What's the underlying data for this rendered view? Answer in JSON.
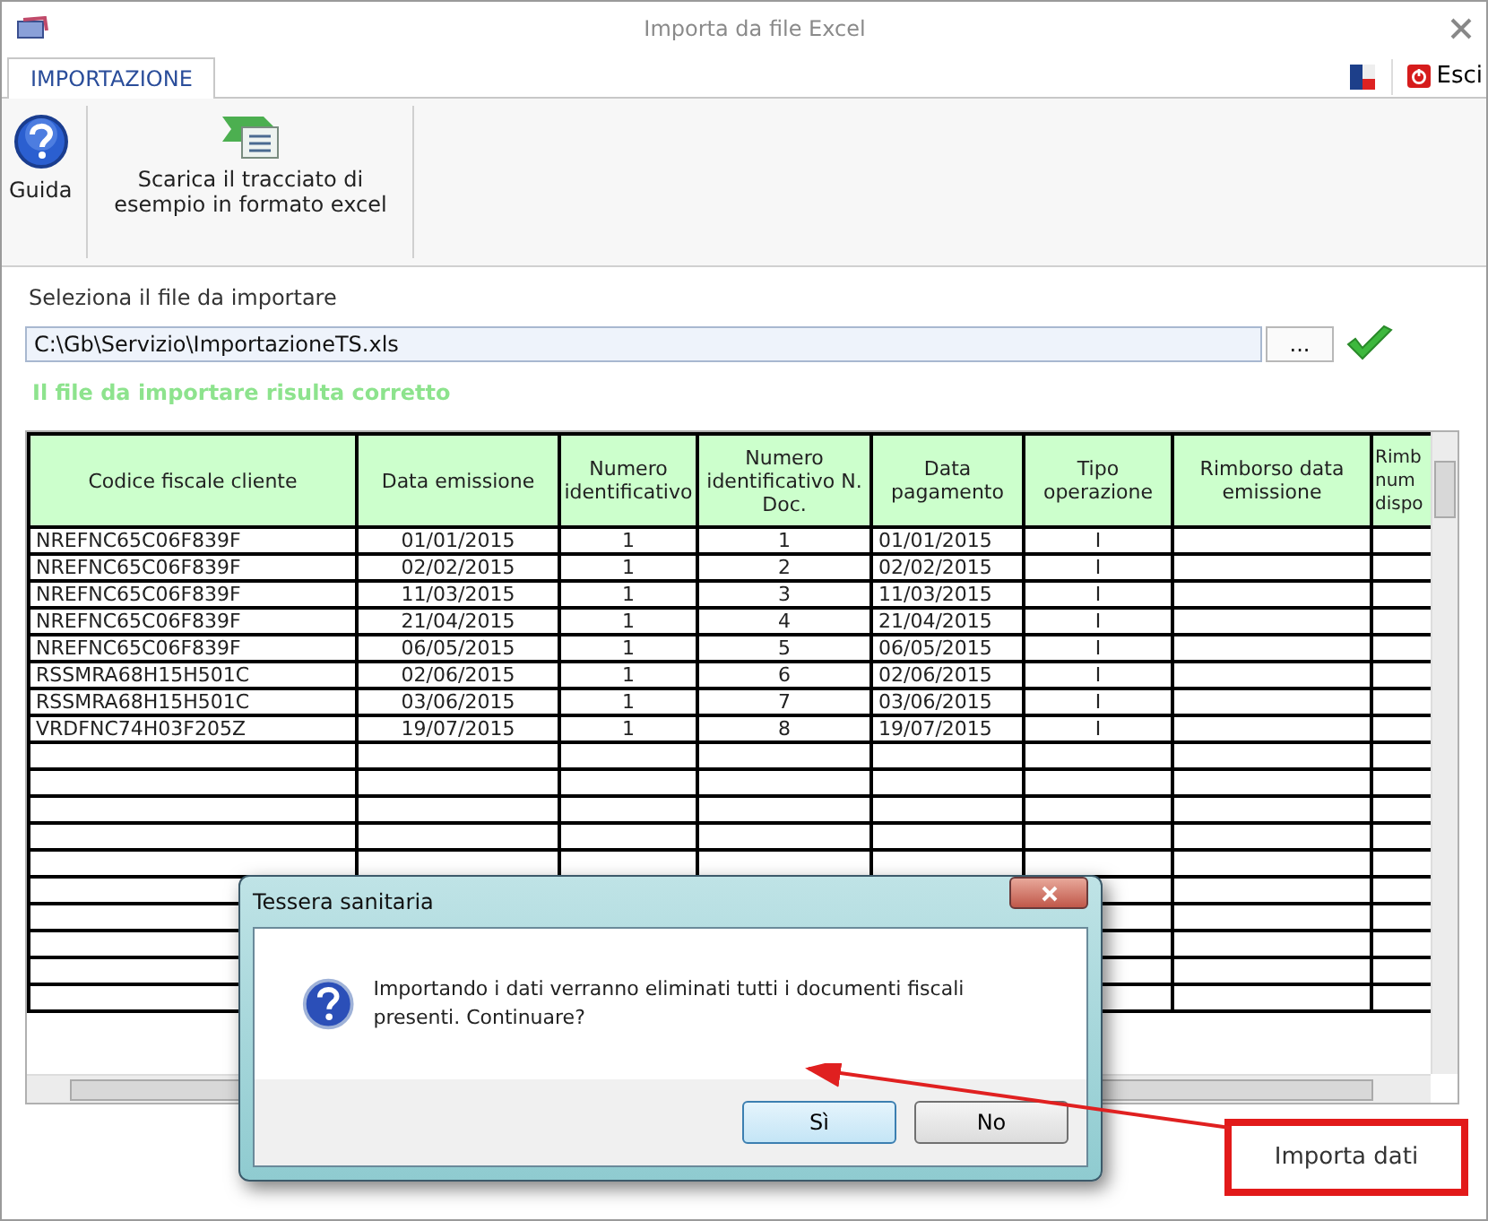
{
  "window": {
    "title": "Importa da file Excel"
  },
  "tabs": [
    {
      "label": "IMPORTAZIONE",
      "selected": true
    }
  ],
  "top_right": {
    "exit_label": "Esci"
  },
  "ribbon": {
    "buttons": [
      {
        "kind": "help",
        "label": "Guida"
      },
      {
        "kind": "excel",
        "label": "Scarica il tracciato di esempio in formato excel"
      }
    ]
  },
  "file": {
    "label": "Seleziona il file da importare",
    "value": "C:\\Gb\\Servizio\\ImportazioneTS.xls",
    "browse": "...",
    "valid": true,
    "status": "Il file da importare risulta corretto"
  },
  "table": {
    "columns": [
      "Codice fiscale cliente",
      "Data emissione",
      "Numero identificativo",
      "Numero identificativo N. Doc.",
      "Data pagamento",
      "Tipo operazione",
      "Rimborso data emissione",
      "Rimb num dispo"
    ],
    "rows": [
      [
        "NREFNC65C06F839F",
        "01/01/2015",
        "1",
        "1",
        "01/01/2015",
        "I"
      ],
      [
        "NREFNC65C06F839F",
        "02/02/2015",
        "1",
        "2",
        "02/02/2015",
        "I"
      ],
      [
        "NREFNC65C06F839F",
        "11/03/2015",
        "1",
        "3",
        "11/03/2015",
        "I"
      ],
      [
        "NREFNC65C06F839F",
        "21/04/2015",
        "1",
        "4",
        "21/04/2015",
        "I"
      ],
      [
        "NREFNC65C06F839F",
        "06/05/2015",
        "1",
        "5",
        "06/05/2015",
        "I"
      ],
      [
        "RSSMRA68H15H501C",
        "02/06/2015",
        "1",
        "6",
        "02/06/2015",
        "I"
      ],
      [
        "RSSMRA68H15H501C",
        "03/06/2015",
        "1",
        "7",
        "03/06/2015",
        "I"
      ],
      [
        "VRDFNC74H03F205Z",
        "19/07/2015",
        "1",
        "8",
        "19/07/2015",
        "I"
      ]
    ]
  },
  "import_button": {
    "label": "Importa dati"
  },
  "dialog": {
    "title": "Tessera sanitaria",
    "message": "Importando i dati verranno eliminati tutti i documenti fiscali presenti. Continuare?",
    "buttons": [
      {
        "label": "Sì",
        "selected": true
      },
      {
        "label": "No",
        "selected": false
      }
    ]
  }
}
